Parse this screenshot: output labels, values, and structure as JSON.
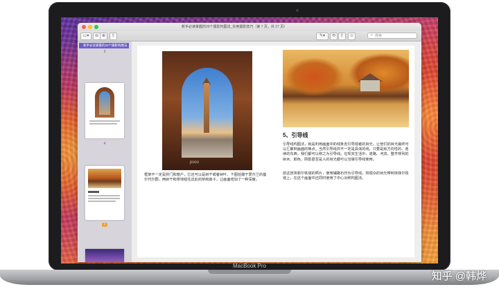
{
  "window": {
    "title": "新手必读掌握的20个摄影构图法_实用摄影技巧（第 7 页，共 27 页）"
  },
  "toolbar": {
    "sidebar_btn": "▭▾",
    "zoom_out": "⊖",
    "zoom_in": "⊕",
    "share": "⇪",
    "pen": "✎▾",
    "rotate": "⟲",
    "export": "⇪",
    "search_placeholder": "搜索"
  },
  "sidebar": {
    "tab_label": "新手必读掌握的20个摄影构图法",
    "pages": [
      {
        "label": "3"
      },
      {
        "label": "4"
      },
      {
        "label": "7"
      }
    ]
  },
  "document": {
    "left_photo_watermark": "poco",
    "left_text": "框架不一定是拱门和窗户，它还可以是树干或者树叶、下图拍摄于爱尔兰的基尔代尔郡，两树干和草地组住这处的桥和房子，让画面增加了一种深度。",
    "right_heading": "5、引导线",
    "right_para1": "引导线构图法，就是利用画面中的线条去引导观者的目光，让他们的目光最终可以汇聚到画面的焦点。当然引导线并不一定是具体的线，只要是有方向性的、连续的东西，我们都可以称之为引导线。在现实生活中，道路、河流、整齐排列的树木、颜色、阴影甚至是人的目光都可以当做引导线使用。",
    "right_para2": "前这张埃菲尔铁塔的照片，使用辅路石作为引导线，将观众的目光带到埃菲尔铁塔上，在这个画面中还同时使用了中心对称构图法。"
  },
  "device": {
    "label": "MacBook Pro"
  },
  "watermark": {
    "text": "知乎 @韩烨"
  }
}
